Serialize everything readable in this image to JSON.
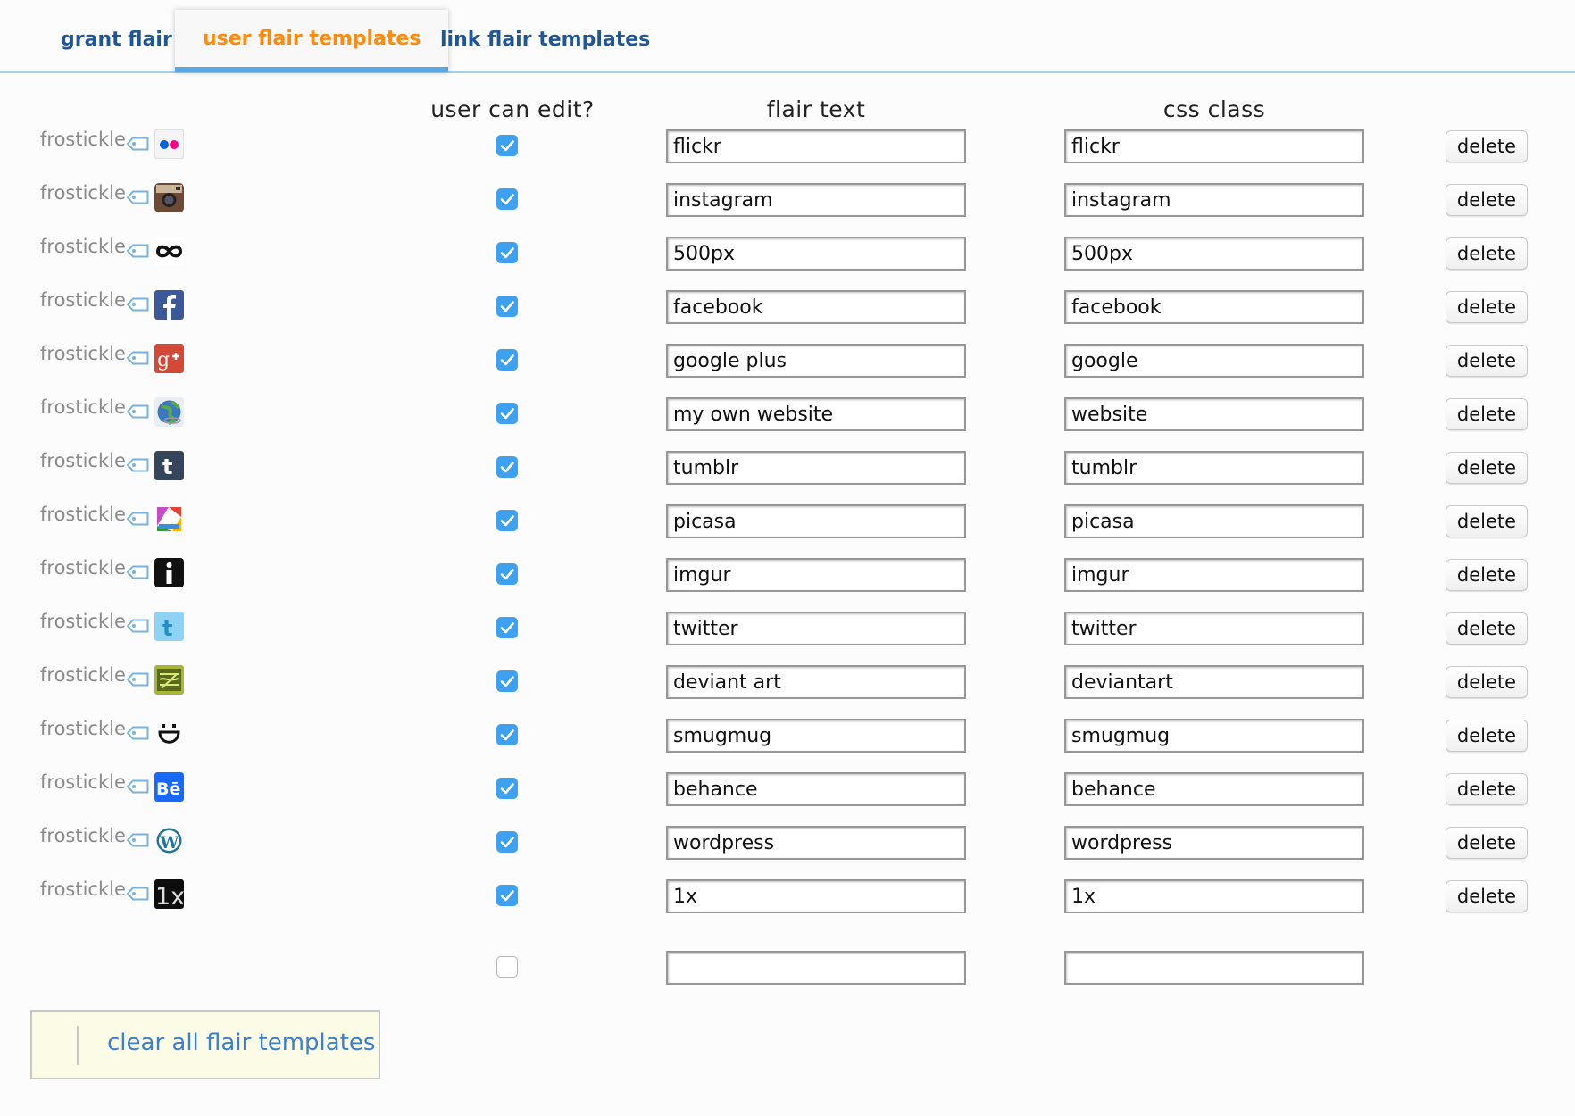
{
  "tabs": [
    {
      "label": "grant flair",
      "active": false
    },
    {
      "label": "user flair templates",
      "active": true
    },
    {
      "label": "link flair templates",
      "active": false
    }
  ],
  "headers": {
    "user_can_edit": "user can edit?",
    "flair_text": "flair text",
    "css_class": "css class"
  },
  "username": "frostickle",
  "delete_label": "delete",
  "rows": [
    {
      "icon": "flickr-icon",
      "editable": true,
      "flair_text": "flickr",
      "css_class": "flickr"
    },
    {
      "icon": "instagram-icon",
      "editable": true,
      "flair_text": "instagram",
      "css_class": "instagram"
    },
    {
      "icon": "500px-icon",
      "editable": true,
      "flair_text": "500px",
      "css_class": "500px"
    },
    {
      "icon": "facebook-icon",
      "editable": true,
      "flair_text": "facebook",
      "css_class": "facebook"
    },
    {
      "icon": "google-plus-icon",
      "editable": true,
      "flair_text": "google plus",
      "css_class": "google"
    },
    {
      "icon": "globe-icon",
      "editable": true,
      "flair_text": "my own website",
      "css_class": "website"
    },
    {
      "icon": "tumblr-icon",
      "editable": true,
      "flair_text": "tumblr",
      "css_class": "tumblr"
    },
    {
      "icon": "picasa-icon",
      "editable": true,
      "flair_text": "picasa",
      "css_class": "picasa"
    },
    {
      "icon": "imgur-icon",
      "editable": true,
      "flair_text": "imgur",
      "css_class": "imgur"
    },
    {
      "icon": "twitter-icon",
      "editable": true,
      "flair_text": "twitter",
      "css_class": "twitter"
    },
    {
      "icon": "deviantart-icon",
      "editable": true,
      "flair_text": "deviant art",
      "css_class": "deviantart"
    },
    {
      "icon": "smugmug-icon",
      "editable": true,
      "flair_text": "smugmug",
      "css_class": "smugmug"
    },
    {
      "icon": "behance-icon",
      "editable": true,
      "flair_text": "behance",
      "css_class": "behance"
    },
    {
      "icon": "wordpress-icon",
      "editable": true,
      "flair_text": "wordpress",
      "css_class": "wordpress"
    },
    {
      "icon": "1x-icon",
      "editable": true,
      "flair_text": "1x",
      "css_class": "1x"
    }
  ],
  "new_row": {
    "editable": false,
    "flair_text": "",
    "css_class": ""
  },
  "clear_all_label": "clear all flair templates",
  "colors": {
    "tab_link": "#1f5796",
    "tab_active": "#ff8b0c",
    "checkbox_on": "#3da1f0",
    "clear_link": "#3a7fd0",
    "clear_bg": "#fbfbe6"
  }
}
